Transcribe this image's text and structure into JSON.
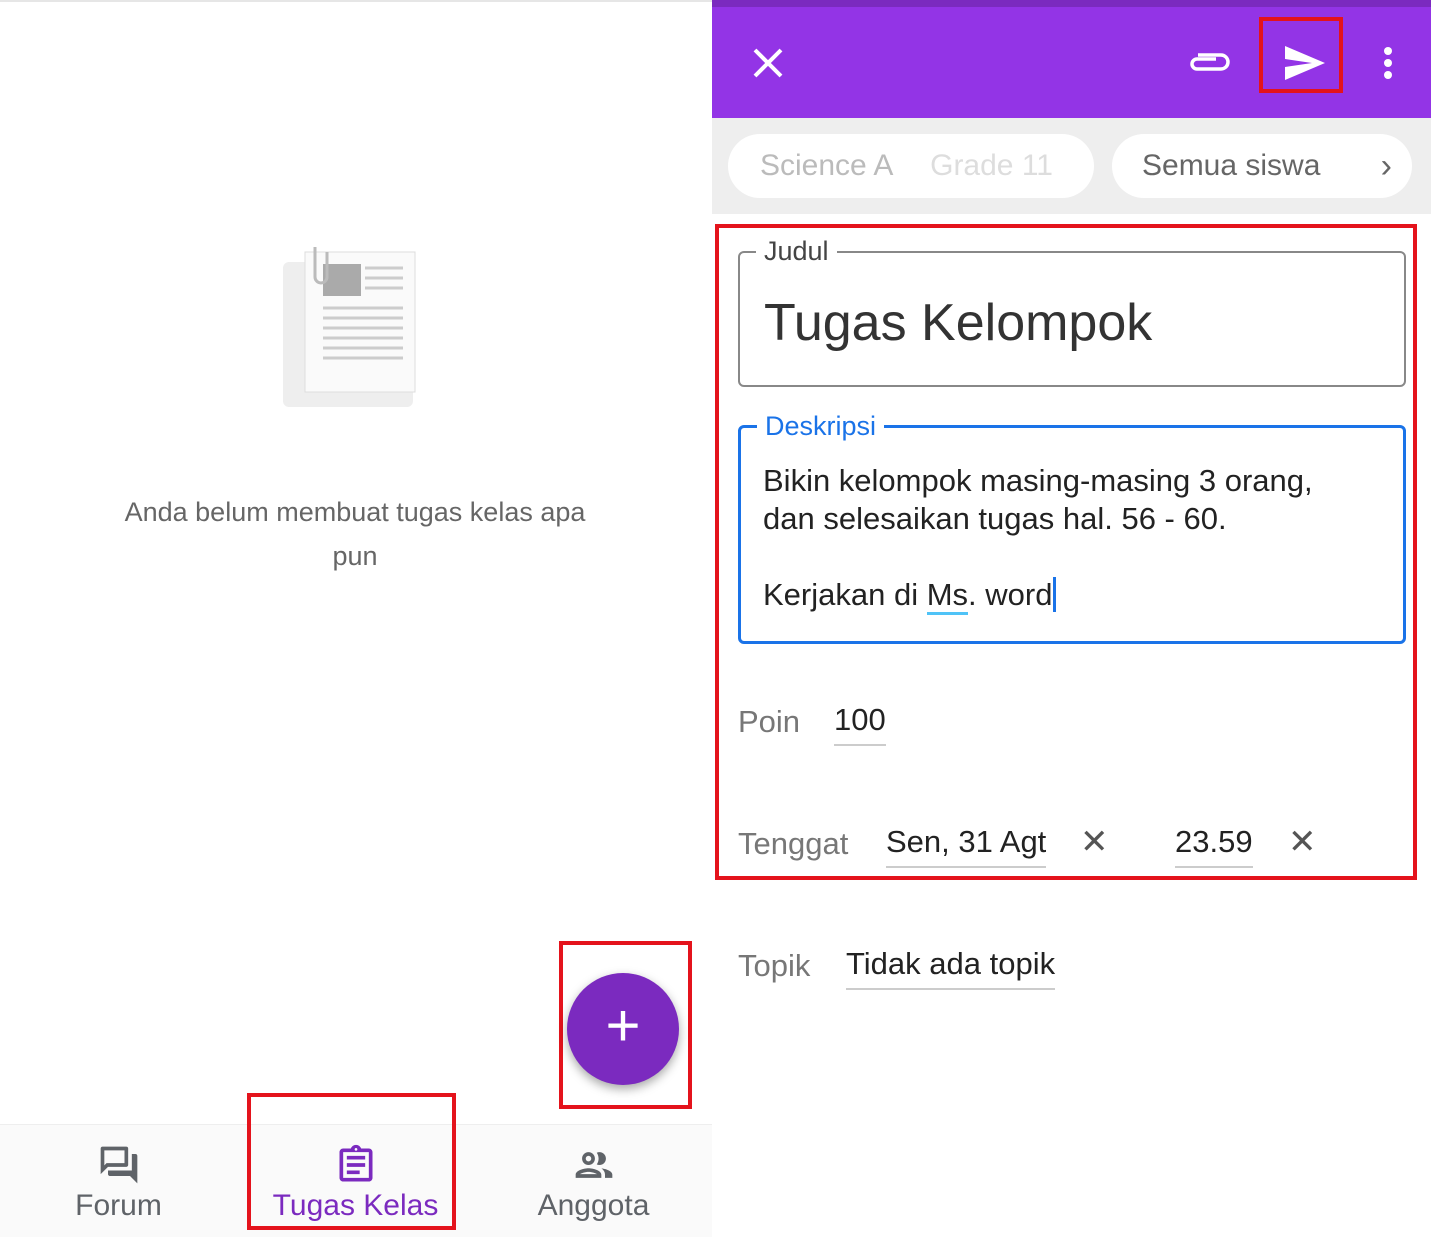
{
  "left": {
    "empty_message": "Anda belum membuat tugas kelas apa pun",
    "fab_label": "+",
    "nav": [
      {
        "label": "Forum",
        "icon": "forum-icon"
      },
      {
        "label": "Tugas Kelas",
        "icon": "assignment-icon"
      },
      {
        "label": "Anggota",
        "icon": "people-icon"
      }
    ]
  },
  "right": {
    "toolbar": {
      "close_icon": "close-icon",
      "attach_icon": "paperclip-icon",
      "send_icon": "send-icon",
      "more_icon": "more-vert-icon"
    },
    "class_chip": {
      "name": "Science A",
      "section": "Grade 11"
    },
    "students_chip": "Semua siswa",
    "title_label": "Judul",
    "title_value": "Tugas Kelompok",
    "desc_label": "Deskripsi",
    "desc_line1": "Bikin kelompok masing-masing 3 orang,",
    "desc_line2": "dan selesaikan tugas hal. 56 - 60.",
    "desc_line3_a": "Kerjakan di ",
    "desc_line3_b": "Ms",
    "desc_line3_c": ". word",
    "points_label": "Poin",
    "points_value": "100",
    "due_label": "Tenggat",
    "due_date": "Sen, 31 Agt",
    "due_time": "23.59",
    "topic_label": "Topik",
    "topic_value": "Tidak ada topik"
  },
  "colors": {
    "accent": "#9334e6",
    "accent_dark": "#7b2abf",
    "focus_blue": "#1a73e8",
    "highlight": "#e4131c"
  }
}
